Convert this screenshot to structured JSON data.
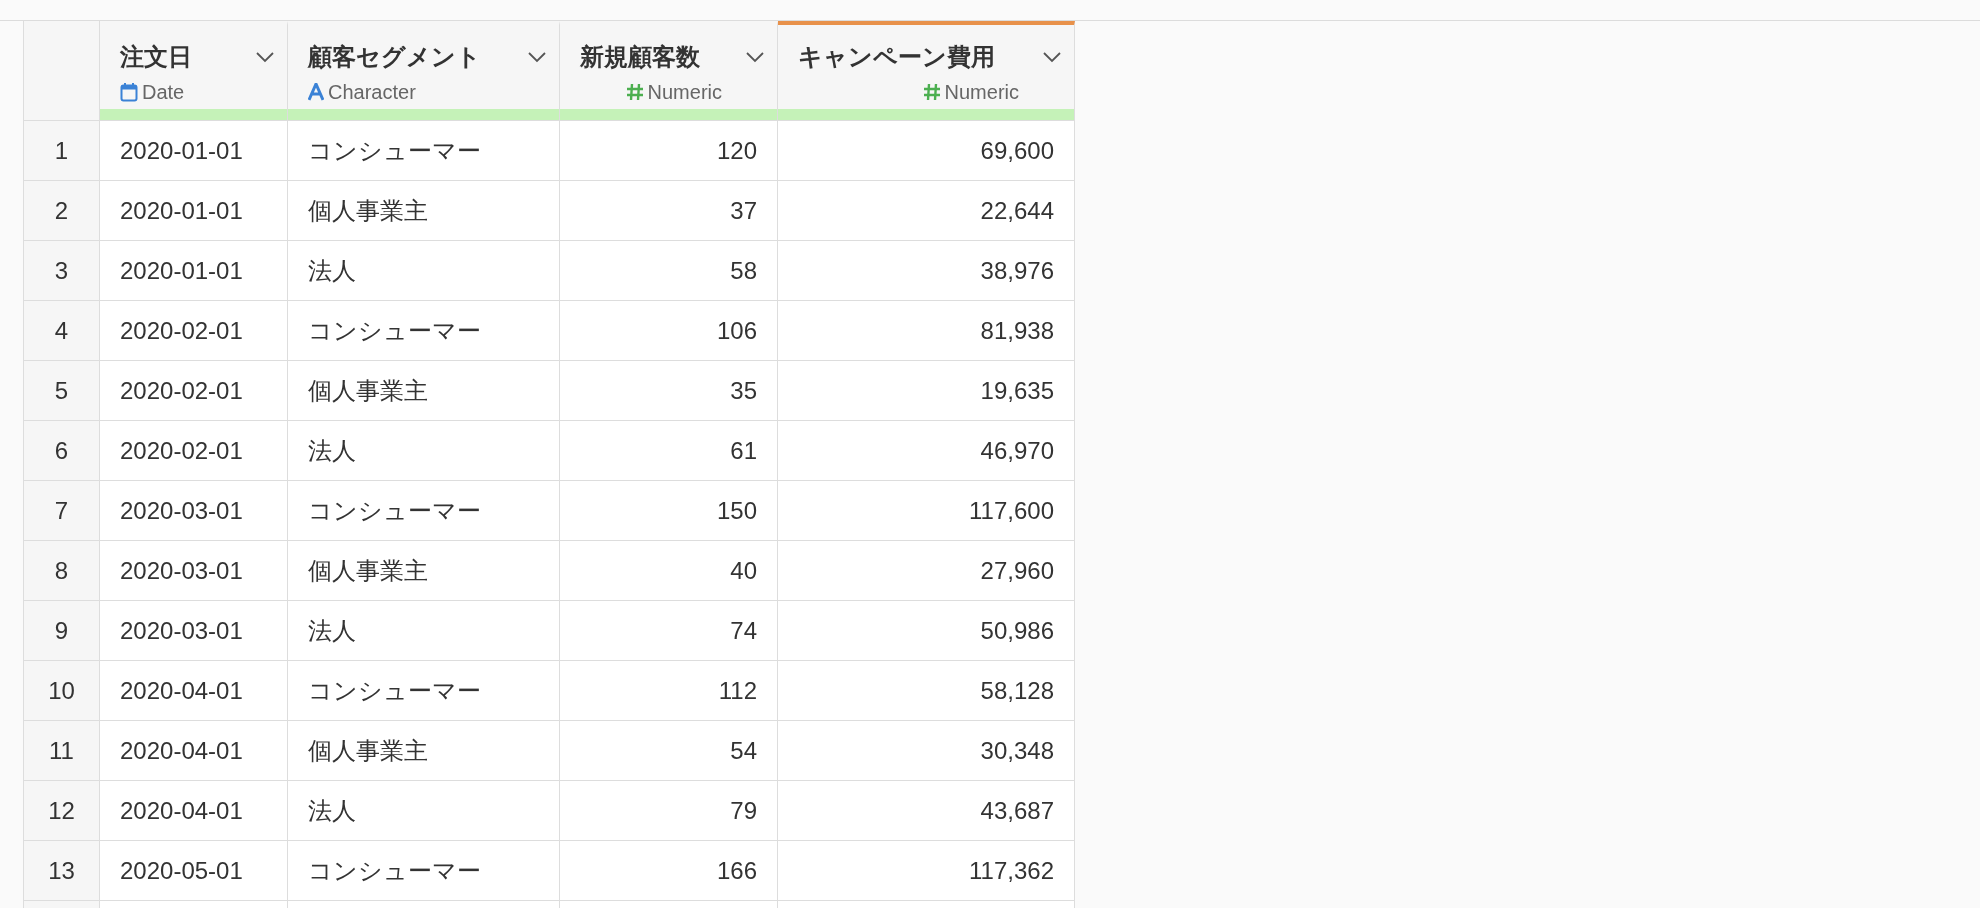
{
  "table": {
    "columns": [
      {
        "name": "注文日",
        "type": "Date",
        "kind": "date",
        "selected": false
      },
      {
        "name": "顧客セグメント",
        "type": "Character",
        "kind": "character",
        "selected": false
      },
      {
        "name": "新規顧客数",
        "type": "Numeric",
        "kind": "numeric",
        "selected": false
      },
      {
        "name": "キャンペーン費用",
        "type": "Numeric",
        "kind": "numeric",
        "selected": true
      }
    ],
    "rows": [
      {
        "index": "1",
        "cells": [
          "2020-01-01",
          "コンシューマー",
          "120",
          "69,600"
        ]
      },
      {
        "index": "2",
        "cells": [
          "2020-01-01",
          "個人事業主",
          "37",
          "22,644"
        ]
      },
      {
        "index": "3",
        "cells": [
          "2020-01-01",
          "法人",
          "58",
          "38,976"
        ]
      },
      {
        "index": "4",
        "cells": [
          "2020-02-01",
          "コンシューマー",
          "106",
          "81,938"
        ]
      },
      {
        "index": "5",
        "cells": [
          "2020-02-01",
          "個人事業主",
          "35",
          "19,635"
        ]
      },
      {
        "index": "6",
        "cells": [
          "2020-02-01",
          "法人",
          "61",
          "46,970"
        ]
      },
      {
        "index": "7",
        "cells": [
          "2020-03-01",
          "コンシューマー",
          "150",
          "117,600"
        ]
      },
      {
        "index": "8",
        "cells": [
          "2020-03-01",
          "個人事業主",
          "40",
          "27,960"
        ]
      },
      {
        "index": "9",
        "cells": [
          "2020-03-01",
          "法人",
          "74",
          "50,986"
        ]
      },
      {
        "index": "10",
        "cells": [
          "2020-04-01",
          "コンシューマー",
          "112",
          "58,128"
        ]
      },
      {
        "index": "11",
        "cells": [
          "2020-04-01",
          "個人事業主",
          "54",
          "30,348"
        ]
      },
      {
        "index": "12",
        "cells": [
          "2020-04-01",
          "法人",
          "79",
          "43,687"
        ]
      },
      {
        "index": "13",
        "cells": [
          "2020-05-01",
          "コンシューマー",
          "166",
          "117,362"
        ]
      }
    ]
  }
}
